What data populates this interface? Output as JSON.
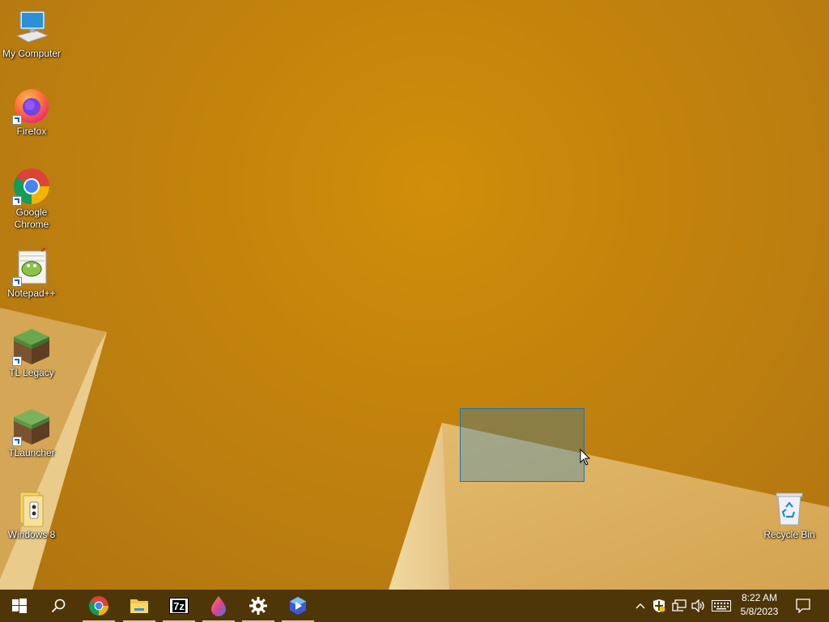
{
  "desktop": {
    "icons": [
      {
        "label": "My Computer",
        "icon": "computer-icon"
      },
      {
        "label": "Firefox",
        "icon": "firefox-icon"
      },
      {
        "label": "Google Chrome",
        "icon": "chrome-icon"
      },
      {
        "label": "Notepad++",
        "icon": "notepadpp-icon"
      },
      {
        "label": "TL Legacy",
        "icon": "grass-block-icon"
      },
      {
        "label": "TLauncher",
        "icon": "grass-block-icon"
      },
      {
        "label": "Windows 8",
        "icon": "folder-icon"
      }
    ],
    "recycle_bin": {
      "label": "Recycle Bin",
      "icon": "recycle-bin-icon"
    }
  },
  "taskbar": {
    "pinned": [
      {
        "name": "start",
        "icon": "windows-logo-icon"
      },
      {
        "name": "search",
        "icon": "search-icon"
      },
      {
        "name": "chrome",
        "icon": "chrome-icon"
      },
      {
        "name": "file-explorer",
        "icon": "folder-icon"
      },
      {
        "name": "7zip",
        "icon": "7zip-icon",
        "text": "7z"
      },
      {
        "name": "paint",
        "icon": "drop-icon"
      },
      {
        "name": "settings",
        "icon": "gear-icon"
      },
      {
        "name": "app",
        "icon": "hexagon-app-icon"
      }
    ],
    "clock": {
      "time": "8:22 AM",
      "date": "5/8/2023"
    }
  },
  "colors": {
    "wallpaper": "#c4840c",
    "taskbar": "#4f3608",
    "selection": "#1e72b8"
  }
}
